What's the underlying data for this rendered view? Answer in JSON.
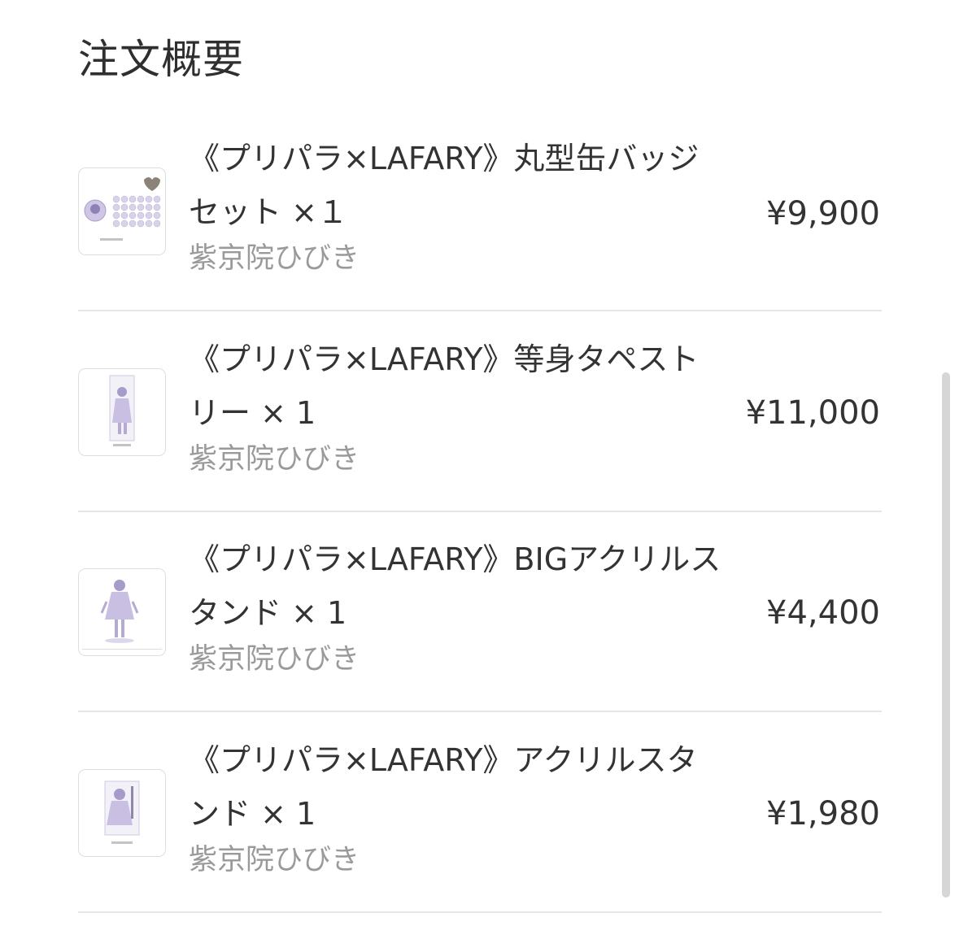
{
  "page": {
    "title": "注文概要"
  },
  "items": [
    {
      "name": "《プリパラ×LAFARY》丸型缶バッジセット ×１",
      "variant": "紫京院ひびき",
      "price": "¥9,900",
      "thumb_icon": "badge-set-product-thumbnail"
    },
    {
      "name": "《プリパラ×LAFARY》等身タペストリー × 1",
      "variant": "紫京院ひびき",
      "price": "¥11,000",
      "thumb_icon": "tapestry-product-thumbnail"
    },
    {
      "name": "《プリパラ×LAFARY》BIGアクリルスタンド × 1",
      "variant": "紫京院ひびき",
      "price": "¥4,400",
      "thumb_icon": "big-acrylic-stand-product-thumbnail"
    },
    {
      "name": "《プリパラ×LAFARY》アクリルスタンド × 1",
      "variant": "紫京院ひびき",
      "price": "¥1,980",
      "thumb_icon": "acrylic-stand-product-thumbnail"
    }
  ],
  "colors": {
    "text_primary": "#333333",
    "text_secondary": "#9a9a9a",
    "divider": "#e6e6e6",
    "thumb_accent": "#b9add6"
  }
}
